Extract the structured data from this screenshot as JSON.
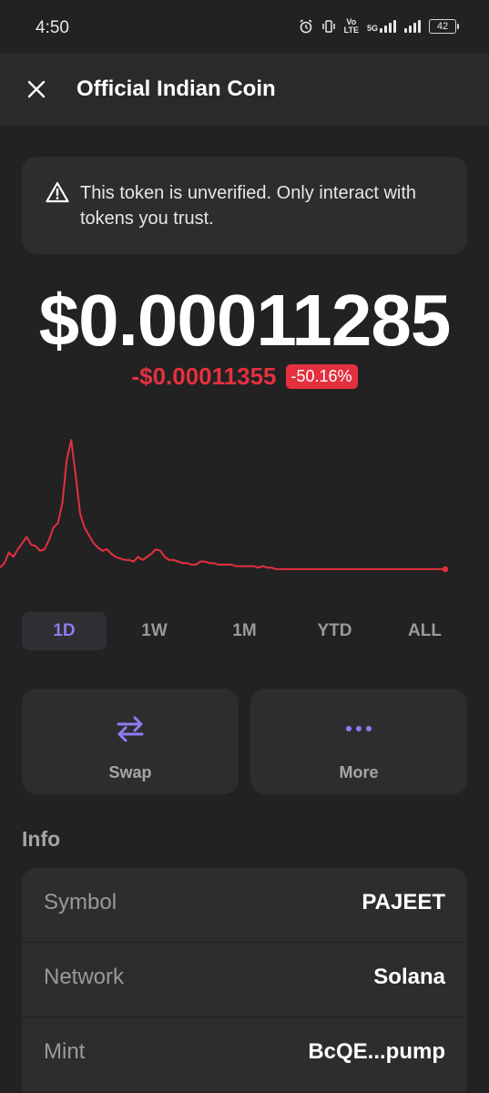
{
  "status_bar": {
    "time": "4:50",
    "network_label_top": "Vo",
    "network_label_bottom": "LTE",
    "data_label": "5G",
    "battery": "42"
  },
  "header": {
    "title": "Official Indian Coin"
  },
  "warning": {
    "text": "This token is unverified. Only interact with tokens you trust."
  },
  "price": {
    "value": "$0.00011285",
    "change_value": "-$0.00011355",
    "change_percent": "-50.16%"
  },
  "colors": {
    "accent": "#8d7cf0",
    "negative": "#e5303f",
    "background": "#222222",
    "card": "#2d2d30"
  },
  "chart_data": {
    "type": "line",
    "x": [
      0,
      1,
      2,
      3,
      4,
      5,
      6,
      7,
      8,
      9,
      10,
      11,
      12,
      13,
      14,
      15,
      16,
      17,
      18,
      19,
      20,
      21,
      22,
      23,
      24,
      25,
      26,
      27,
      28,
      29,
      30,
      31,
      32,
      33,
      34,
      35,
      36,
      37,
      38,
      39,
      40,
      41,
      42,
      43,
      44,
      45,
      46,
      47,
      48,
      49,
      50,
      51,
      52,
      53,
      54,
      55,
      56,
      57,
      58,
      59,
      60,
      61,
      62,
      63,
      64,
      65,
      66,
      67,
      68,
      69,
      70,
      71,
      72,
      73,
      74,
      75,
      76,
      77,
      78,
      79,
      80,
      81,
      82,
      83,
      84,
      85,
      86,
      87,
      88,
      89,
      90,
      91,
      92,
      93,
      94,
      95,
      96,
      97,
      98,
      99,
      100
    ],
    "values": [
      0.4,
      0.7,
      1.4,
      1.1,
      1.6,
      2.0,
      2.4,
      1.9,
      1.8,
      1.5,
      1.6,
      2.2,
      3.0,
      3.3,
      4.6,
      7.4,
      8.7,
      6.4,
      3.9,
      3.0,
      2.5,
      2.0,
      1.7,
      1.5,
      1.6,
      1.3,
      1.1,
      1.0,
      0.9,
      0.9,
      0.8,
      1.1,
      0.9,
      1.1,
      1.3,
      1.6,
      1.5,
      1.1,
      0.9,
      0.9,
      0.8,
      0.7,
      0.7,
      0.6,
      0.6,
      0.8,
      0.8,
      0.7,
      0.7,
      0.6,
      0.6,
      0.6,
      0.6,
      0.5,
      0.5,
      0.5,
      0.5,
      0.5,
      0.4,
      0.5,
      0.4,
      0.4,
      0.3,
      0.3,
      0.3,
      0.3,
      0.3,
      0.3,
      0.3,
      0.3,
      0.3,
      0.3,
      0.3,
      0.3,
      0.3,
      0.3,
      0.3,
      0.3,
      0.3,
      0.3,
      0.3,
      0.3,
      0.3,
      0.3,
      0.3,
      0.3,
      0.3,
      0.3,
      0.3,
      0.3,
      0.3,
      0.3,
      0.3,
      0.3,
      0.3,
      0.3,
      0.3,
      0.3,
      0.3,
      0.3,
      0.3
    ],
    "ylim": [
      0,
      9
    ],
    "grid": false,
    "line_color": "#e5303f"
  },
  "range_tabs": [
    {
      "label": "1D",
      "active": true
    },
    {
      "label": "1W",
      "active": false
    },
    {
      "label": "1M",
      "active": false
    },
    {
      "label": "YTD",
      "active": false
    },
    {
      "label": "ALL",
      "active": false
    }
  ],
  "actions": {
    "swap_label": "Swap",
    "swap_icon": "swap-arrows-icon",
    "more_label": "More",
    "more_icon": "ellipsis-icon"
  },
  "info": {
    "heading": "Info",
    "rows": [
      {
        "label": "Symbol",
        "value": "PAJEET"
      },
      {
        "label": "Network",
        "value": "Solana"
      },
      {
        "label": "Mint",
        "value": "BcQE...pump"
      }
    ]
  }
}
